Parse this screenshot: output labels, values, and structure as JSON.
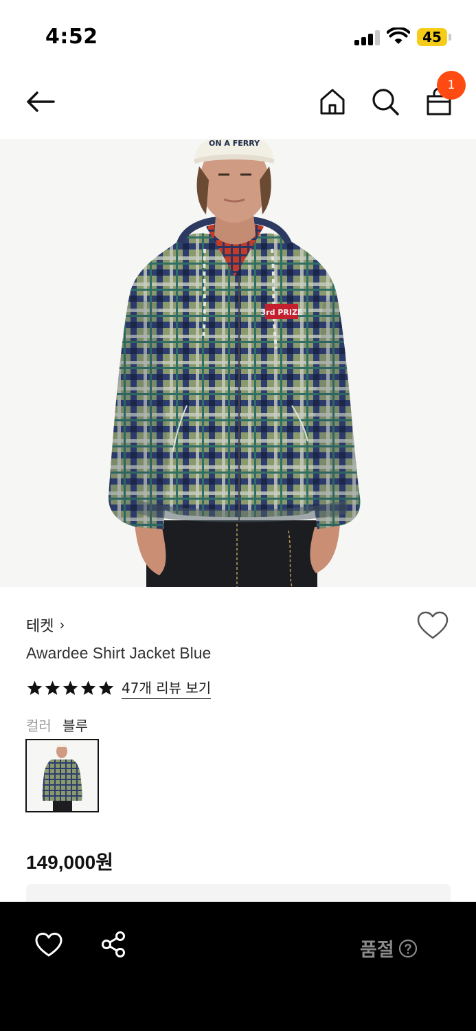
{
  "status_bar": {
    "time": "4:52",
    "battery": "45",
    "icons": [
      "signal-icon",
      "wifi-icon",
      "battery-icon"
    ]
  },
  "nav": {
    "icons": [
      "back-arrow-icon",
      "home-icon",
      "search-icon",
      "shopping-bag-icon"
    ],
    "cart_count": "1",
    "badge_color": "#ff4b12"
  },
  "product": {
    "brand": "테켓",
    "brand_chevron": "›",
    "name": "Awardee Shirt Jacket Blue",
    "rating": 5,
    "review_link": "47개 리뷰 보기",
    "color_label": "컬러",
    "color_value": "블루",
    "price": "149,000원",
    "image_cap_text": "ON A FERRY",
    "image_patch_text": "3rd PRIZE"
  },
  "bottom_bar": {
    "icons": [
      "heart-icon",
      "share-icon",
      "help-circle-icon"
    ],
    "status_label": "품절",
    "background": "#000000"
  }
}
